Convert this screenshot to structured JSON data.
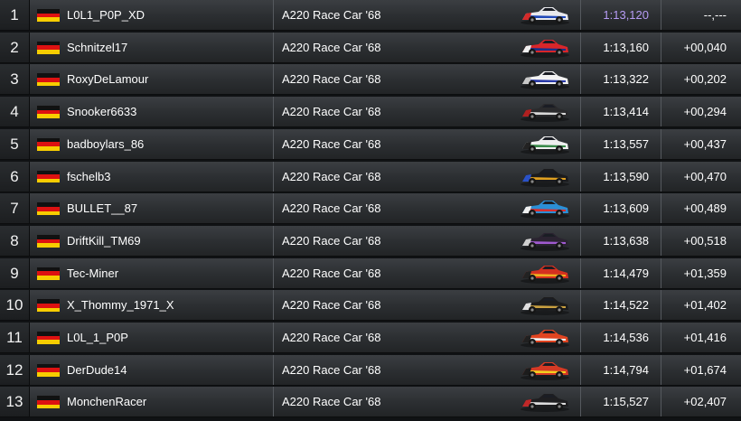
{
  "leaderboard": {
    "rows": [
      {
        "position": "1",
        "driver": "L0L1_P0P_XD",
        "car": "A220 Race Car '68",
        "time": "1:13,120",
        "gap": "--,---",
        "car_colors": [
          "#e8e8ec",
          "#2148b8",
          "#d42a2a"
        ]
      },
      {
        "position": "2",
        "driver": "Schnitzel17",
        "car": "A220 Race Car '68",
        "time": "1:13,160",
        "gap": "+00,040",
        "car_colors": [
          "#d9262a",
          "#1a2f8a",
          "#f0f0f0"
        ]
      },
      {
        "position": "3",
        "driver": "RoxyDeLamour",
        "car": "A220 Race Car '68",
        "time": "1:13,322",
        "gap": "+00,202",
        "car_colors": [
          "#f2f2f2",
          "#2a3aa8",
          "#c8c8c8"
        ]
      },
      {
        "position": "4",
        "driver": "Snooker6633",
        "car": "A220 Race Car '68",
        "time": "1:13,414",
        "gap": "+00,294",
        "car_colors": [
          "#2a2a2c",
          "#d8d8d8",
          "#b02020"
        ]
      },
      {
        "position": "5",
        "driver": "badboylars_86",
        "car": "A220 Race Car '68",
        "time": "1:13,557",
        "gap": "+00,437",
        "car_colors": [
          "#efefef",
          "#3a8a4a",
          "#222222"
        ]
      },
      {
        "position": "6",
        "driver": "fschelb3",
        "car": "A220 Race Car '68",
        "time": "1:13,590",
        "gap": "+00,470",
        "car_colors": [
          "#1b1b1d",
          "#e0a020",
          "#2a52c8"
        ]
      },
      {
        "position": "7",
        "driver": "BULLET__87",
        "car": "A220 Race Car '68",
        "time": "1:13,609",
        "gap": "+00,489",
        "car_colors": [
          "#2b8fd6",
          "#d83030",
          "#f0f0f0"
        ]
      },
      {
        "position": "8",
        "driver": "DriftKill_TM69",
        "car": "A220 Race Car '68",
        "time": "1:13,638",
        "gap": "+00,518",
        "car_colors": [
          "#2a2330",
          "#a05ad0",
          "#cfcfcf"
        ]
      },
      {
        "position": "9",
        "driver": "Tec-Miner",
        "car": "A220 Race Car '68",
        "time": "1:14,479",
        "gap": "+01,359",
        "car_colors": [
          "#d43020",
          "#f0b020",
          "#222222"
        ]
      },
      {
        "position": "10",
        "driver": "X_Thommy_1971_X",
        "car": "A220 Race Car '68",
        "time": "1:14,522",
        "gap": "+01,402",
        "car_colors": [
          "#1c1c1c",
          "#c9a040",
          "#e0e0e0"
        ]
      },
      {
        "position": "11",
        "driver": "L0L_1_P0P",
        "car": "A220 Race Car '68",
        "time": "1:14,536",
        "gap": "+01,416",
        "car_colors": [
          "#e04420",
          "#f0f0f0",
          "#202020"
        ]
      },
      {
        "position": "12",
        "driver": "DerDude14",
        "car": "A220 Race Car '68",
        "time": "1:14,794",
        "gap": "+01,674",
        "car_colors": [
          "#d63a24",
          "#f2d020",
          "#1c1c1c"
        ]
      },
      {
        "position": "13",
        "driver": "MonchenRacer",
        "car": "A220 Race Car '68",
        "time": "1:15,527",
        "gap": "+02,407",
        "car_colors": [
          "#1e1e20",
          "#dcdcdc",
          "#c02828"
        ]
      }
    ],
    "best_time_color": "#b69cf5",
    "flag_icon": "germany-flag-icon",
    "car_icon": "race-car-icon"
  }
}
